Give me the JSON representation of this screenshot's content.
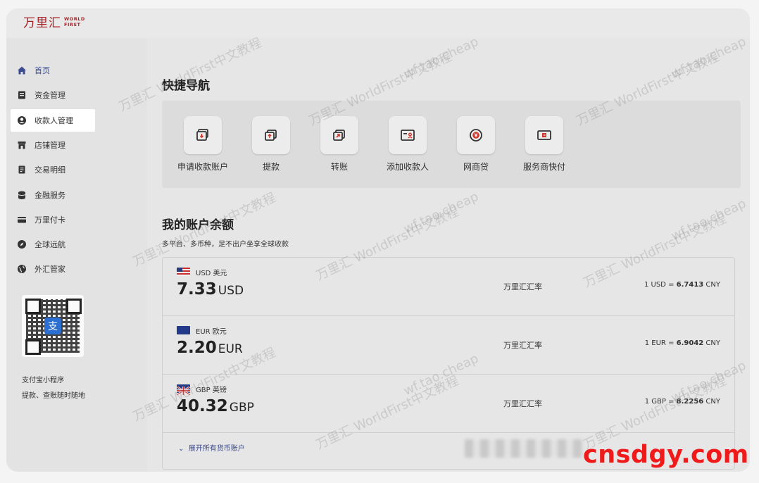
{
  "logo": {
    "cn": "万里汇",
    "en_line1": "WORLD",
    "en_line2": "FIRST"
  },
  "sidebar": {
    "items": [
      {
        "label": "首页",
        "icon": "home-icon"
      },
      {
        "label": "资金管理",
        "icon": "ledger-icon"
      },
      {
        "label": "收款人管理",
        "icon": "user-icon"
      },
      {
        "label": "店铺管理",
        "icon": "store-icon"
      },
      {
        "label": "交易明细",
        "icon": "document-icon"
      },
      {
        "label": "金融服务",
        "icon": "finance-icon"
      },
      {
        "label": "万里付卡",
        "icon": "card-icon"
      },
      {
        "label": "全球远航",
        "icon": "compass-icon"
      },
      {
        "label": "外汇管家",
        "icon": "globe-icon"
      }
    ],
    "active_index": 2,
    "mini_program_title": "支付宝小程序",
    "mini_program_desc": "提款、查账随时随地",
    "qr_logo": "支"
  },
  "quick_nav": {
    "title": "快捷导航",
    "actions": [
      {
        "label": "申请收款账户",
        "icon": "receive-account-icon"
      },
      {
        "label": "提款",
        "icon": "withdraw-icon"
      },
      {
        "label": "转账",
        "icon": "transfer-icon"
      },
      {
        "label": "添加收款人",
        "icon": "add-payee-icon"
      },
      {
        "label": "网商贷",
        "icon": "loan-icon"
      },
      {
        "label": "服务商快付",
        "icon": "quick-pay-icon"
      }
    ]
  },
  "balances": {
    "title": "我的账户余额",
    "subtitle": "多平台、多币种，足不出户坐享全球收款",
    "rate_label": "万里汇汇率",
    "accounts": [
      {
        "currency": "USD 美元",
        "amount": "7.33",
        "unit": "USD",
        "rate_left": "1 USD",
        "rate_value": "6.7413",
        "rate_unit": "CNY",
        "flag": "us-flag-icon"
      },
      {
        "currency": "EUR 欧元",
        "amount": "2.20",
        "unit": "EUR",
        "rate_left": "1 EUR",
        "rate_value": "6.9042",
        "rate_unit": "CNY",
        "flag": "eu-flag-icon"
      },
      {
        "currency": "GBP 英镑",
        "amount": "40.32",
        "unit": "GBP",
        "rate_left": "1 GBP",
        "rate_value": "8.2256",
        "rate_unit": "CNY",
        "flag": "uk-flag-icon"
      }
    ],
    "expand_label": "展开所有货币账户",
    "expand_icon": "chevron-down-icon"
  },
  "watermark": {
    "text1": "万里汇 WorldFirst中文教程",
    "text2": "wf.tao.cheap"
  },
  "brand_watermark": "cnsdgy.com",
  "colors": {
    "brand_red": "#a61f24",
    "link_blue": "#3a4b8f",
    "watermark_red": "#f11a1a"
  }
}
